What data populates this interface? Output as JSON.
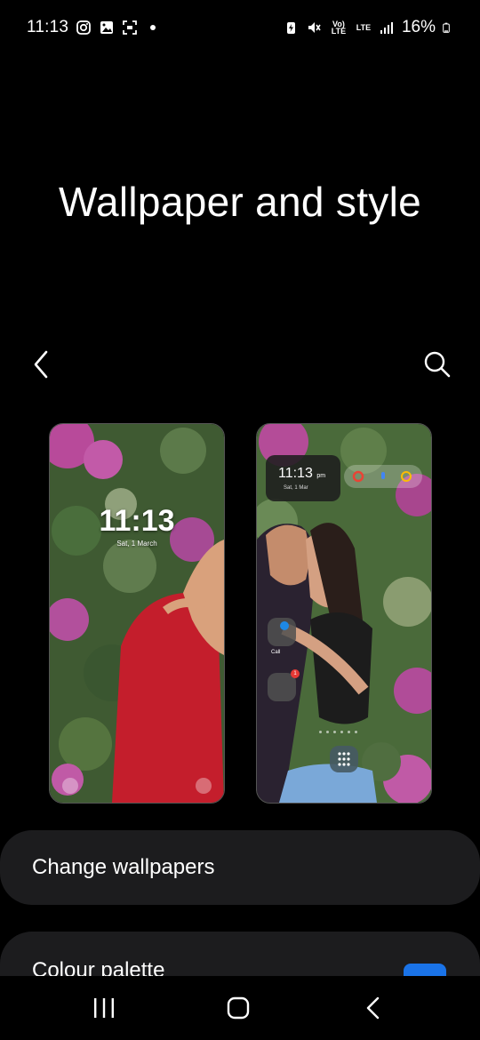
{
  "status_bar": {
    "time": "11:13",
    "left_icons": [
      "instagram-icon",
      "gallery-icon",
      "screenshot-icon",
      "notification-dot-icon"
    ],
    "volte": "Vo) LTE",
    "lte": "LTE",
    "battery_percent": "16%"
  },
  "page": {
    "title": "Wallpaper and style"
  },
  "lock_preview": {
    "time": "11:13",
    "date": "Sat, 1 March"
  },
  "home_preview": {
    "clock_time": "11:13",
    "clock_ampm": "pm",
    "clock_date": "Sat, 1 Mar",
    "folder_label": "Call",
    "badge_count": "1"
  },
  "options": {
    "change_wallpapers": "Change wallpapers",
    "colour_palette": "Colour palette"
  },
  "colors": {
    "accent_blue": "#1a73e8",
    "card_bg": "#1c1c1e"
  }
}
